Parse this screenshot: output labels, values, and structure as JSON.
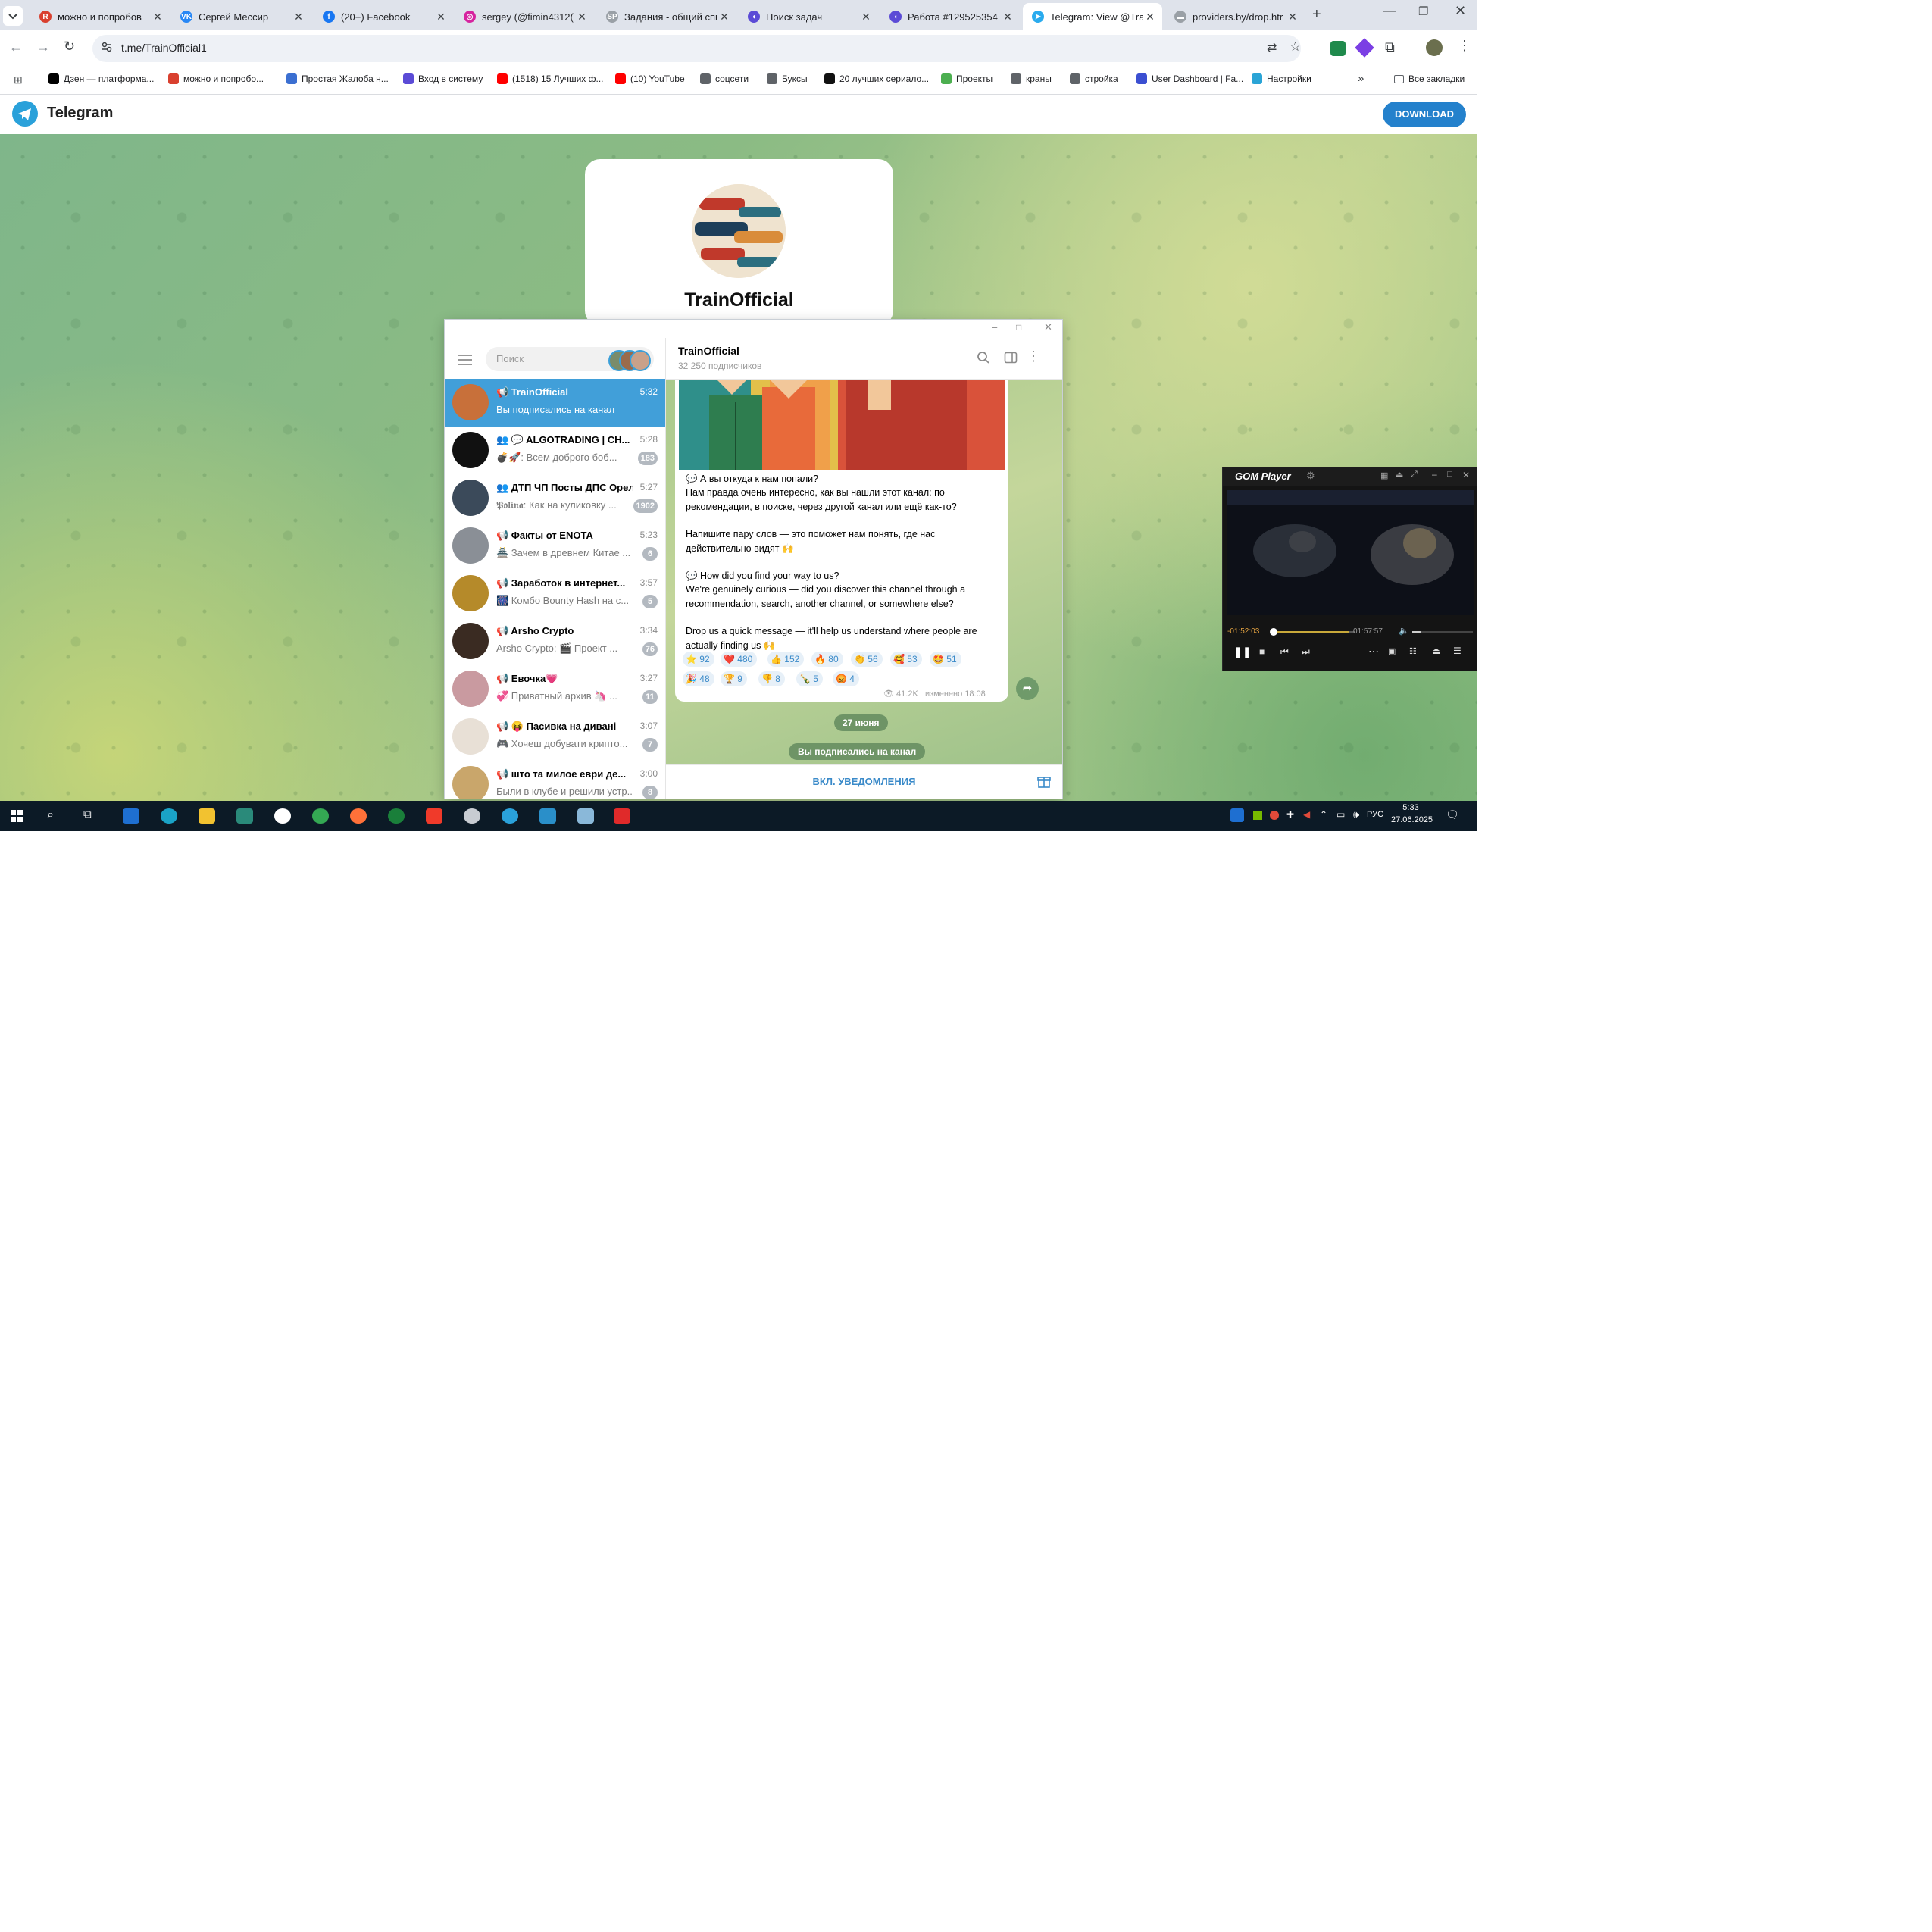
{
  "browser": {
    "tabs": [
      {
        "title": "можно и попробов",
        "fav_color": "#d9402f",
        "fav_text": "R"
      },
      {
        "title": "Сергей Мессир",
        "fav_color": "#2787f5",
        "fav_text": "VK"
      },
      {
        "title": "(20+) Facebook",
        "fav_color": "#1877f2",
        "fav_text": "f"
      },
      {
        "title": "sergey (@fimin4312(",
        "fav_color": "#d6249f",
        "fav_text": "◎"
      },
      {
        "title": "Задания - общий спи",
        "fav_color": "#9aa0a6",
        "fav_text": "SP"
      },
      {
        "title": "Поиск задач",
        "fav_color": "#5b4bd6",
        "fav_text": "◖"
      },
      {
        "title": "Работа #129525354 -",
        "fav_color": "#5b4bd6",
        "fav_text": "◖"
      },
      {
        "title": "Telegram: View @Tra",
        "fav_color": "#2aabee",
        "fav_text": "➤"
      },
      {
        "title": "providers.by/drop.htr",
        "fav_color": "#9aa0a6",
        "fav_text": "▬"
      }
    ],
    "url": "t.me/TrainOfficial1",
    "bookmarks": [
      {
        "label": "Дзен — платформа...",
        "color": "#000000"
      },
      {
        "label": "можно и попробо...",
        "color": "#d9402f"
      },
      {
        "label": "Простая Жалоба н...",
        "color": "#3b6fd1"
      },
      {
        "label": "Вход в систему",
        "color": "#5b4bd6"
      },
      {
        "label": "(1518) 15 Лучших ф...",
        "color": "#ff0000"
      },
      {
        "label": "(10) YouTube",
        "color": "#ff0000"
      },
      {
        "label": "соцсети",
        "color": "#5f6368"
      },
      {
        "label": "Буксы",
        "color": "#5f6368"
      },
      {
        "label": "20 лучших сериало...",
        "color": "#111111"
      },
      {
        "label": "Проекты",
        "color": "#4caf50"
      },
      {
        "label": "краны",
        "color": "#5f6368"
      },
      {
        "label": "стройка",
        "color": "#5f6368"
      },
      {
        "label": "User Dashboard | Fa...",
        "color": "#3b4fd1"
      },
      {
        "label": "Настройки",
        "color": "#2aa4d6"
      }
    ],
    "all_bookmarks": "Все закладки"
  },
  "tgweb": {
    "brand": "Telegram",
    "download": "DOWNLOAD",
    "channel_title": "TrainOfficial"
  },
  "app": {
    "search_placeholder": "Поиск",
    "chats": [
      {
        "name": "📢 TrainOfficial",
        "time": "5:32",
        "preview": "Вы подписались на канал",
        "badge": "",
        "avatar": "#c8703a",
        "selected": true
      },
      {
        "name": "👥 💬 ALGOTRADING | CH...",
        "time": "5:28",
        "preview": "💣🚀: Всем доброго боб...",
        "badge": "183",
        "avatar": "#111111"
      },
      {
        "name": "👥 ДТП ЧП Посты ДПС Орел",
        "time": "5:27",
        "preview": "𝕻𝖔𝖑𝖎𝖓𝖆: Как на куликовку ...",
        "badge": "1902",
        "avatar": "#3b4a5a"
      },
      {
        "name": "📢 Факты от ENOTA",
        "time": "5:23",
        "preview": "🏯 Зачем в древнем Китае ...",
        "badge": "6",
        "avatar": "#8a8f96"
      },
      {
        "name": "📢 Заработок в интернет...",
        "time": "3:57",
        "preview": "🎆 Комбо Bounty Hash на с...",
        "badge": "5",
        "avatar": "#b58a2a"
      },
      {
        "name": "📢 Arsho Crypto",
        "time": "3:34",
        "preview": "Arsho Crypto: 🎬 Проект ...",
        "badge": "76",
        "avatar": "#3a2b22"
      },
      {
        "name": "📢 Евочка💗",
        "time": "3:27",
        "preview": "💞 Приватный архив 🦄 ...",
        "badge": "11",
        "avatar": "#c99aa0"
      },
      {
        "name": "📢 😝 Пасивка на дивані",
        "time": "3:07",
        "preview": "🎮 Хочеш добувати крипто...",
        "badge": "7",
        "avatar": "#e8e0d6"
      },
      {
        "name": "📢 што та милое еври де...",
        "time": "3:00",
        "preview": "Были в клубе и решили устр...",
        "badge": "8",
        "avatar": "#c9a66b"
      }
    ],
    "channel_name": "TrainOfficial",
    "subscribers": "32 250 подписчиков",
    "message_lines": [
      "💬 А вы откуда к нам попали?",
      "Нам правда очень интересно, как вы нашли этот канал: по",
      "рекомендации, в поиске, через другой канал или ещё как-то?",
      "",
      "Напишите пару слов — это поможет нам понять, где нас",
      "действительно видят 🙌",
      "",
      "💬 How did you find your way to us?",
      "We're genuinely curious — did you discover this channel through a",
      "recommendation, search, another channel, or somewhere else?",
      "",
      "Drop us a quick message — it'll help us understand where people are",
      "actually finding us 🙌"
    ],
    "reactions_row1": [
      {
        "emoji": "⭐",
        "count": "92"
      },
      {
        "emoji": "❤️",
        "count": "480"
      },
      {
        "emoji": "👍",
        "count": "152"
      },
      {
        "emoji": "🔥",
        "count": "80"
      },
      {
        "emoji": "👏",
        "count": "56"
      },
      {
        "emoji": "🥰",
        "count": "53"
      },
      {
        "emoji": "🤩",
        "count": "51"
      }
    ],
    "reactions_row2": [
      {
        "emoji": "🎉",
        "count": "48"
      },
      {
        "emoji": "🏆",
        "count": "9"
      },
      {
        "emoji": "👎",
        "count": "8"
      },
      {
        "emoji": "🍾",
        "count": "5"
      },
      {
        "emoji": "😡",
        "count": "4"
      }
    ],
    "views": "41.2K",
    "edited": "изменено 18:08",
    "date_chip": "27 июня",
    "service_msg": "Вы подписались на канал",
    "notify_button": "ВКЛ. УВЕДОМЛЕНИЯ"
  },
  "gom": {
    "title": "GOM Player",
    "elapsed": "-01:52:03",
    "total": "01:57:57"
  },
  "taskbar": {
    "lang": "РУС",
    "time": "5:33",
    "date": "27.06.2025"
  }
}
